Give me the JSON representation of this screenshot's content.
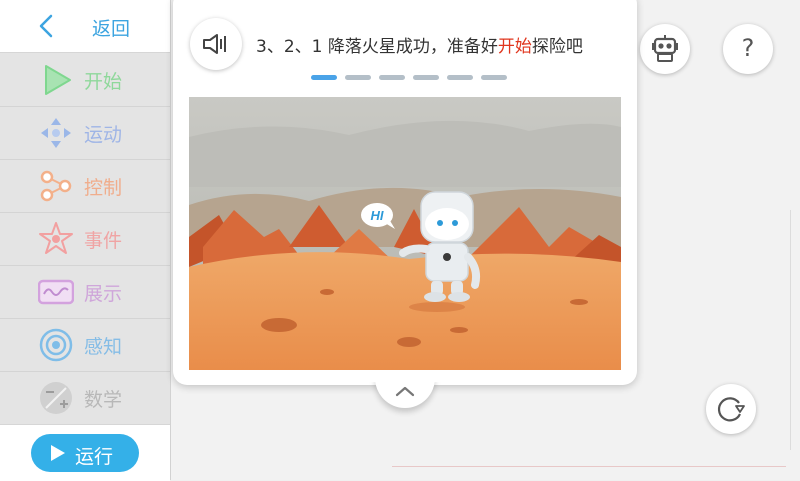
{
  "sidebar": {
    "back_label": "返回",
    "categories": [
      {
        "label": "开始",
        "icon": "play-triangle-icon",
        "color": "#7fd78f",
        "text_color": "#8fd89b"
      },
      {
        "label": "运动",
        "icon": "move-arrows-icon",
        "color": "#9bb7e8",
        "text_color": "#9fb5e6"
      },
      {
        "label": "控制",
        "icon": "branch-nodes-icon",
        "color": "#f3b08a",
        "text_color": "#f0ad8c"
      },
      {
        "label": "事件",
        "icon": "star-atom-icon",
        "color": "#f2a0a0",
        "text_color": "#f0a4a4"
      },
      {
        "label": "展示",
        "icon": "wave-screen-icon",
        "color": "#d3a2de",
        "text_color": "#cfa6da"
      },
      {
        "label": "感知",
        "icon": "signal-icon",
        "color": "#7fbde8",
        "text_color": "#86bde6"
      },
      {
        "label": "数学",
        "icon": "math-symbols-icon",
        "color": "#bdbdbd",
        "text_color": "#b8b8b8"
      }
    ],
    "run_label": "运行"
  },
  "tutorial": {
    "caption_before": "3、2、1 降落火星成功，准备好",
    "caption_highlight": "开始",
    "caption_after": "探险吧",
    "steps_total": 6,
    "step_current": 1,
    "speech_bubble": "HI"
  },
  "colors": {
    "accent": "#34b0e8",
    "highlight": "#e0361e"
  }
}
